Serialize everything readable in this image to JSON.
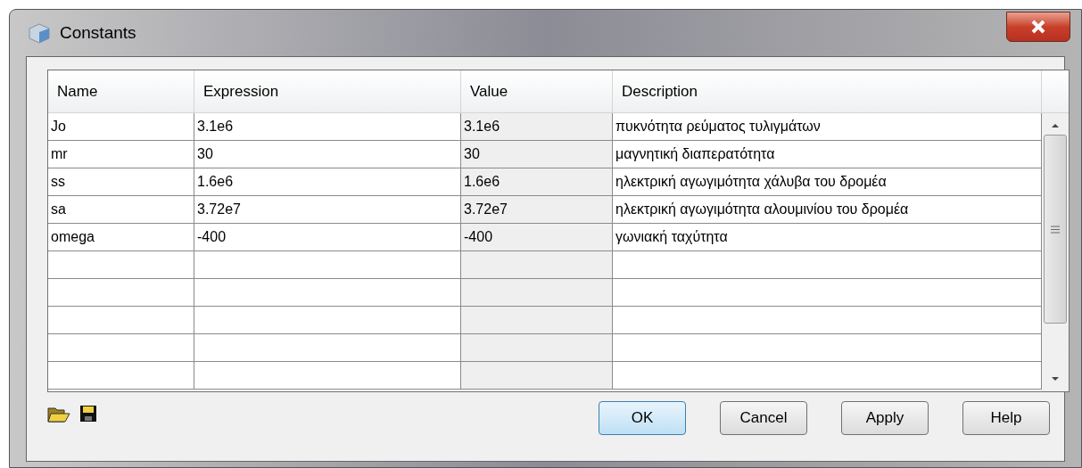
{
  "window": {
    "title": "Constants"
  },
  "table": {
    "columns": [
      "Name",
      "Expression",
      "Value",
      "Description"
    ],
    "rows": [
      {
        "name": "Jo",
        "expression": "3.1e6",
        "value": "3.1e6",
        "description": "πυκνότητα ρεύματος τυλιγμάτων"
      },
      {
        "name": "mr",
        "expression": "30",
        "value": "30",
        "description": "μαγνητική διαπερατότητα"
      },
      {
        "name": "ss",
        "expression": "1.6e6",
        "value": "1.6e6",
        "description": "ηλεκτρική αγωγιμότητα χάλυβα του δρομέα"
      },
      {
        "name": "sa",
        "expression": "3.72e7",
        "value": "3.72e7",
        "description": "ηλεκτρική αγωγιμότητα αλουμινίου του δρομέα"
      },
      {
        "name": "omega",
        "expression": "-400",
        "value": "-400",
        "description": "γωνιακή ταχύτητα"
      }
    ]
  },
  "buttons": [
    {
      "label": "OK",
      "default": true
    },
    {
      "label": "Cancel",
      "default": false
    },
    {
      "label": "Apply",
      "default": false
    },
    {
      "label": "Help",
      "default": false
    }
  ]
}
